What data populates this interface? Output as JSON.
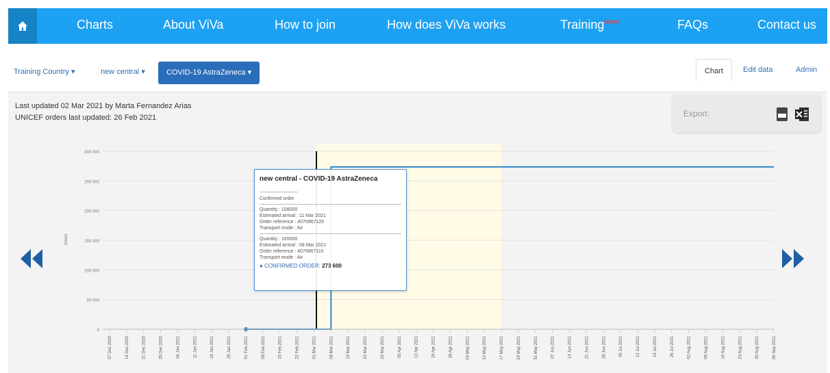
{
  "nav": {
    "home_icon": "home-icon",
    "items": [
      "Charts",
      "About ViVa",
      "How to join",
      "How does ViVa works",
      "Training",
      "FAQs",
      "Contact us"
    ],
    "training_badge": "New!"
  },
  "subbar": {
    "country": "Training Country",
    "store": "new central",
    "product": "COVID-19 AstraZeneca",
    "tabs": [
      "Chart",
      "Edit data",
      "Admin"
    ]
  },
  "meta": {
    "last_updated": "Last updated 02 Mar 2021 by Marta Fernandez Arias",
    "orders_updated": "UNICEF orders last updated: 26 Feb 2021"
  },
  "export": {
    "label": "Export:",
    "icons": [
      "pdf-icon",
      "excel-icon"
    ]
  },
  "arrows": {
    "prev": "double-left-arrow-icon",
    "next": "double-right-arrow-icon"
  },
  "tooltip": {
    "title": "new central - COVID-19 AstraZeneca",
    "dashes": "------------------------",
    "section": "Confirmed order",
    "order1": [
      "Quantity : 108000",
      "Estimated arrival : 11 Mar 2021",
      "Order reference : 4070867120",
      "Transport mode : Air"
    ],
    "order2": [
      "Quantity : 165600",
      "Estimated arrival : 08 Mar 2021",
      "Order reference : 4070867110",
      "Transport mode : Air"
    ],
    "total_label": "● CONFIRMED ORDER:",
    "total_value": "273 600"
  },
  "colors": {
    "nav": "#1da1f2",
    "accent": "#2a6ebb",
    "line": "#2f86c6",
    "highlight": "#fffbe6"
  },
  "chart_data": {
    "type": "line",
    "ylabel": "Doses",
    "ylim": [
      0,
      300000
    ],
    "yticks": [
      "300 000",
      "250 000",
      "200 000",
      "150 000",
      "100 000",
      "50 000",
      "0"
    ],
    "x": [
      "07 Dec 2020",
      "14 Dec 2020",
      "21 Dec 2020",
      "28 Dec 2020",
      "04 Jan 2021",
      "11 Jan 2021",
      "18 Jan 2021",
      "25 Jan 2021",
      "01 Feb 2021",
      "08 Feb 2021",
      "15 Feb 2021",
      "22 Feb 2021",
      "01 Mar 2021",
      "08 Mar 2021",
      "15 Mar 2021",
      "22 Mar 2021",
      "29 Mar 2021",
      "05 Apr 2021",
      "12 Apr 2021",
      "19 Apr 2021",
      "26 Apr 2021",
      "03 May 2021",
      "10 May 2021",
      "17 May 2021",
      "24 May 2021",
      "31 May 2021",
      "07 Jun 2021",
      "14 Jun 2021",
      "21 Jun 2021",
      "28 Jun 2021",
      "05 Jul 2021",
      "12 Jul 2021",
      "19 Jul 2021",
      "26 Jul 2021",
      "02 Aug 2021",
      "09 Aug 2021",
      "16 Aug 2021",
      "23 Aug 2021",
      "30 Aug 2021",
      "06 Sep 2021"
    ],
    "series": [
      {
        "points": [
          [
            "01 Feb 2021",
            0
          ],
          [
            "08 Mar 2021",
            0
          ],
          [
            "08 Mar 2021",
            273600
          ],
          [
            "06 Sep 2021",
            273600
          ]
        ]
      }
    ],
    "current_date": "02 Mar 2021"
  }
}
